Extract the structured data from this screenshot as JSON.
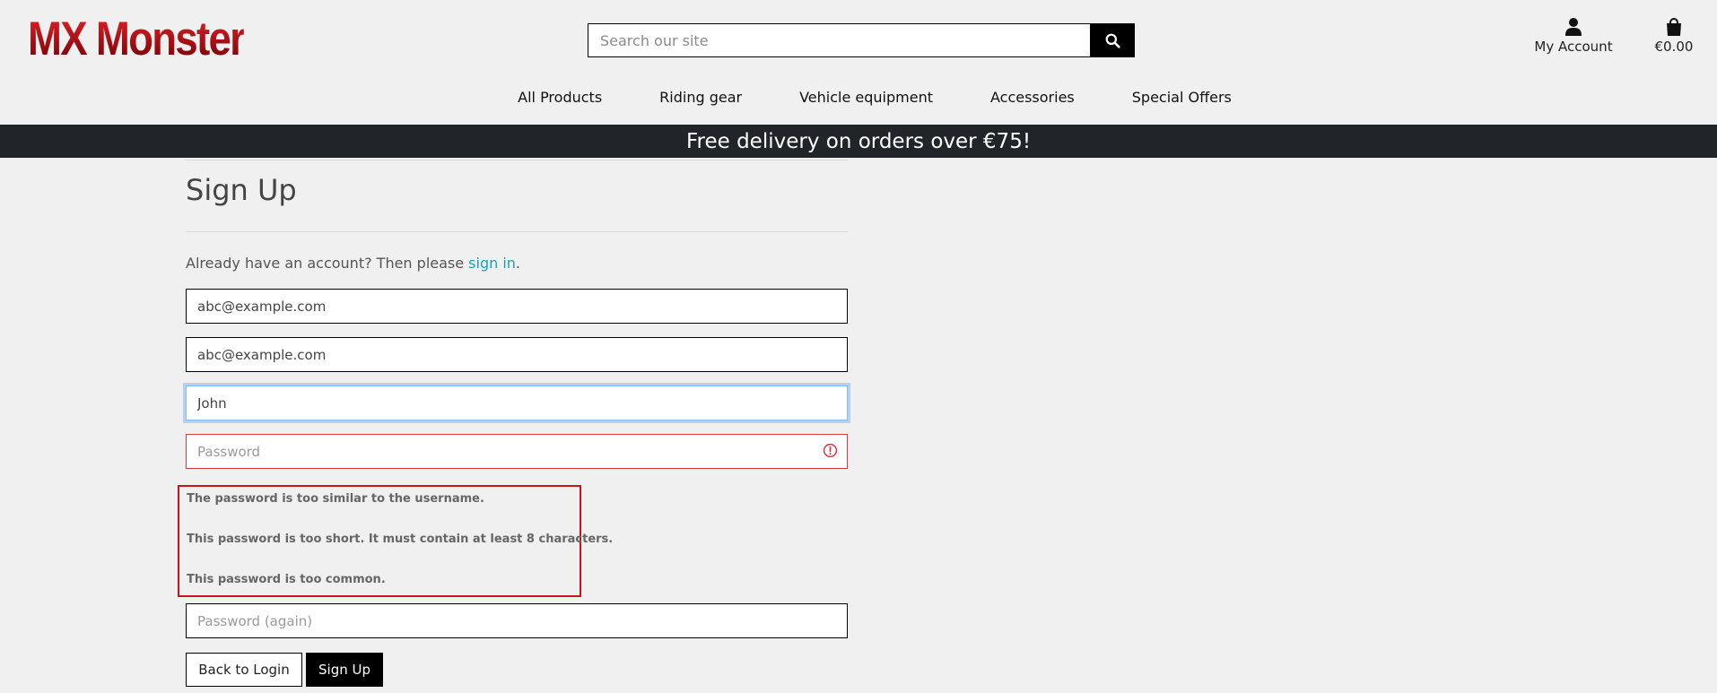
{
  "header": {
    "logo_text": "MX Monster",
    "search_placeholder": "Search our site",
    "account_label": "My Account",
    "cart_total": "€0.00"
  },
  "nav": {
    "items": [
      {
        "label": "All Products"
      },
      {
        "label": "Riding gear"
      },
      {
        "label": "Vehicle equipment"
      },
      {
        "label": "Accessories"
      },
      {
        "label": "Special Offers"
      }
    ]
  },
  "banner": {
    "text": "Free delivery on orders over €75!"
  },
  "form": {
    "title": "Sign Up",
    "intro_prefix": "Already have an account? Then please ",
    "intro_link": "sign in",
    "intro_suffix": ".",
    "email_value": "abc@example.com",
    "email_confirm_value": "abc@example.com",
    "username_value": "John",
    "password_placeholder": "Password",
    "password_again_placeholder": "Password (again)",
    "errors": [
      "The password is too similar to the username.",
      "This password is too short. It must contain at least 8 characters.",
      "This password is too common."
    ],
    "back_button": "Back to Login",
    "submit_button": "Sign Up"
  },
  "colors": {
    "brand_red": "#c8141b",
    "banner_bg": "#212529",
    "link": "#17a2b8",
    "invalid": "#dc3545"
  }
}
